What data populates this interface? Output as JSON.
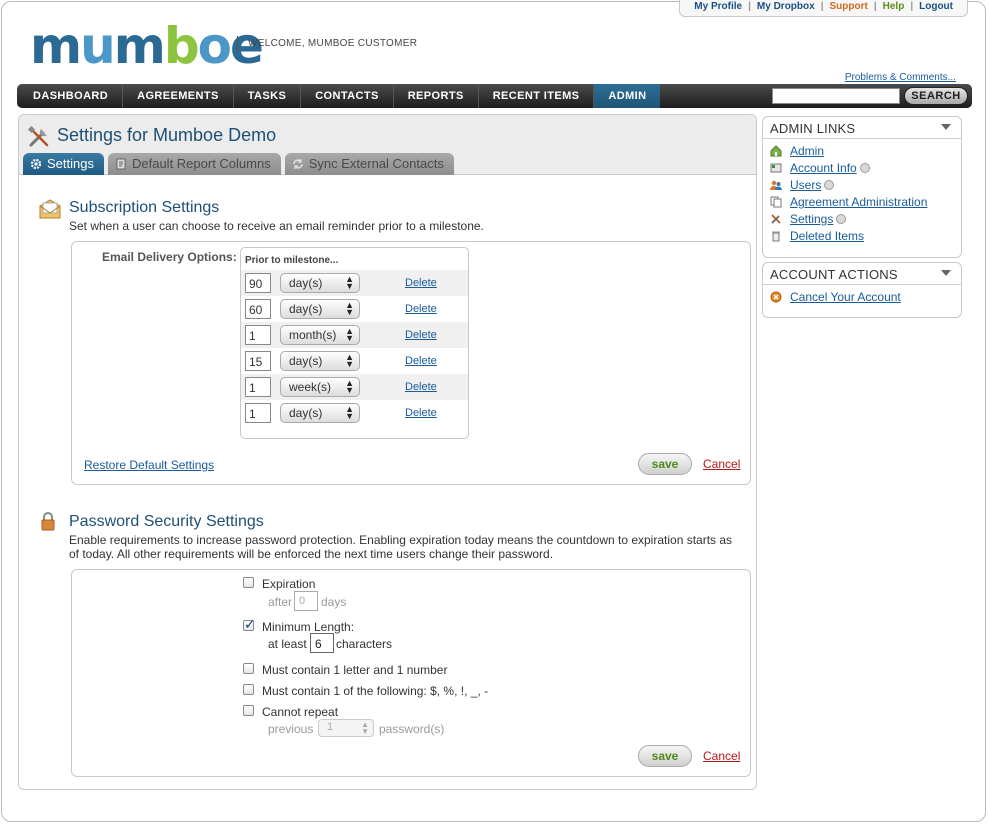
{
  "top_links": [
    "My Profile",
    "My Dropbox",
    "Support",
    "Help",
    "Logout"
  ],
  "brand": {
    "logo_text": "mumboe",
    "welcome": "WELCOME, MUMBOE CUSTOMER"
  },
  "problems_link": "Problems & Comments...",
  "nav": {
    "items": [
      "DASHBOARD",
      "AGREEMENTS",
      "TASKS",
      "CONTACTS",
      "REPORTS",
      "RECENT ITEMS",
      "ADMIN"
    ],
    "active": "ADMIN",
    "search_value": "",
    "search_button": "SEARCH"
  },
  "page": {
    "title": "Settings for Mumboe Demo",
    "tabs": [
      "Settings",
      "Default Report Columns",
      "Sync External Contacts"
    ]
  },
  "subscription": {
    "title": "Subscription Settings",
    "description": "Set when a user can choose to receive an email reminder prior to a milestone.",
    "delivery_label": "Email Delivery Options:",
    "prior_header": "Prior to milestone...",
    "rows": [
      {
        "value": "90",
        "unit": "day(s)"
      },
      {
        "value": "60",
        "unit": "day(s)"
      },
      {
        "value": "1",
        "unit": "month(s)"
      },
      {
        "value": "15",
        "unit": "day(s)"
      },
      {
        "value": "1",
        "unit": "week(s)"
      },
      {
        "value": "1",
        "unit": "day(s)"
      }
    ],
    "delete_label": "Delete",
    "restore_link": "Restore Default Settings",
    "save": "save",
    "cancel": "Cancel"
  },
  "password": {
    "title": "Password Security Settings",
    "description_line1": "Enable requirements to increase password protection. Enabling expiration today means the countdown to expiration starts as",
    "description_line2": "of today. All other requirements will be enforced the next time users change their password.",
    "expiration_label": "Expiration",
    "after_label": "after",
    "expiration_value": "0",
    "days_label": "days",
    "min_length_label": "Minimum Length:",
    "at_least_label": "at least",
    "min_length_value": "6",
    "characters_label": "characters",
    "letter_number_label": "Must contain 1 letter and 1 number",
    "special_label": "Must contain 1 of the following: $, %, !, _, -",
    "repeat_label": "Cannot repeat",
    "previous_label": "previous",
    "previous_value": "1",
    "passwords_label": "password(s)",
    "checks": {
      "expiration": false,
      "min_length": true,
      "letter_number": false,
      "special": false,
      "repeat": false
    },
    "save": "save",
    "cancel": "Cancel"
  },
  "sidebar": {
    "admin_links_title": "ADMIN LINKS",
    "admin_links": [
      "Admin",
      "Account Info",
      "Users",
      "Agreement Administration",
      "Settings",
      "Deleted Items"
    ],
    "account_actions_title": "ACCOUNT ACTIONS",
    "account_actions": [
      "Cancel Your Account"
    ]
  },
  "colors": {
    "nav_active": "#1f5b82",
    "title_blue": "#1f4f74",
    "link_blue": "#1a5b9a",
    "save_green": "#4e8a1b",
    "cancel_red": "#b5161b"
  }
}
